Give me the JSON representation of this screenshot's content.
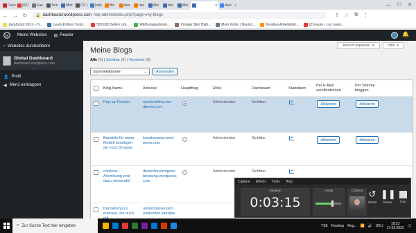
{
  "browser": {
    "tabs": [
      {
        "label": "Cezu",
        "color": "#c62828"
      },
      {
        "label": "(62)",
        "color": "#e53935"
      },
      {
        "label": "Kae",
        "color": "#777777"
      },
      {
        "label": "Tem",
        "color": "#555555"
      },
      {
        "label": "Moti",
        "color": "#3d6cb3"
      },
      {
        "label": "CV L",
        "color": "#555555"
      },
      {
        "label": "Inde",
        "color": "#3b7fc4"
      },
      {
        "label": "Blo",
        "color": "#f57c00"
      },
      {
        "label": "den",
        "color": "#f57c00"
      },
      {
        "label": "neu",
        "color": "#f57c00"
      },
      {
        "label": "Mei",
        "color": "#3d6cb3"
      },
      {
        "label": "Mei",
        "color": "#3d6cb3"
      },
      {
        "label": "Mei",
        "color": "#3d6cb3"
      },
      {
        "label": "",
        "color": "#3d6cb3"
      },
      {
        "label": "deut",
        "color": "#4285f4"
      }
    ],
    "new_tab_label": "+",
    "window_controls": [
      "—",
      "☐",
      "✕"
    ],
    "url_domain": "dashboard.wordpress.com",
    "url_path": "/wp-admin/index.php?page=my-blogs",
    "bookmarks": [
      {
        "label": "JavaScript 2021 – Ti...",
        "color": "#f0db4f"
      },
      {
        "label": "Learn Python Tutori...",
        "color": "#3776ab"
      },
      {
        "label": "582.000 Seiten Unt...",
        "color": "#e53935"
      },
      {
        "label": "WEB-paspadorws...",
        "color": "#4caf50"
      },
      {
        "label": "Vintage Slim High...",
        "color": "#8d6e63"
      },
      {
        "label": "Mein Konto | Deutsc...",
        "color": "#607d8b"
      },
      {
        "label": "Kreative Arbeitsblät...",
        "color": "#ff9800"
      },
      {
        "label": "(2) Fauré - Les roses...",
        "color": "#e53935"
      }
    ]
  },
  "adminbar": {
    "my_sites": "Meine Websites",
    "reader": "Reader"
  },
  "sidebar": {
    "back": "Websites durchstöbern",
    "site_name": "Global Dashboard",
    "site_url": "dashboard.wordpress.com",
    "profile": "Profil",
    "collapse": "Menü einklappen"
  },
  "main": {
    "screen_options": "Ansicht anpassen",
    "help": "Hilfe",
    "title": "Meine Blogs",
    "filter_all": "Alle",
    "filter_all_count": "(6)",
    "filter_visible": "Sichtbar",
    "filter_visible_count": "(6)",
    "filter_hidden": "Versteckt",
    "filter_hidden_count": "(0)",
    "sep": "|",
    "bulk_actions": "Sammelaktionen",
    "apply": "Anwenden"
  },
  "table": {
    "headers": {
      "name": "Blog-Name",
      "address": "Adresse",
      "main_blog": "Hauptblog",
      "role": "Rolle",
      "dashboard": "Dashboard",
      "stats": "Statistiken",
      "email_1": "Per E-Mail",
      "email_2": "veröffentlichen",
      "vote_1": "Per Stimme",
      "vote_2": "bloggen"
    },
    "rows": [
      {
        "name": [
          "Pop-up-Fenster"
        ],
        "address": [
          "murdemilkey.wor",
          "dpress.com"
        ],
        "role": "Administrator",
        "dashboard": "Sichtbar",
        "email": "Aktivieren",
        "vote": "Aktivieren",
        "main": true
      },
      {
        "name": [
          "Bausteln für unser",
          "Modell benötigen",
          "wir noch Dropout"
        ],
        "address": [
          "konakovanja.word",
          "press.com"
        ],
        "role": "Administrator",
        "dashboard": "Sichtbar",
        "email": "Aktivieren",
        "vote": "Aktivieren",
        "main": false
      },
      {
        "name": [
          "continue -",
          "Anweisung wird",
          "dazu verwendet"
        ],
        "address": [
          "deutschevermgens",
          "beratung.wordpress",
          "com"
        ],
        "role": "Administrator",
        "dashboard": "Sichtbar",
        "email": "",
        "vote": "",
        "main": false
      },
      {
        "name": [
          "Darstellung zu",
          "erlernen, die auch",
          "mit"
        ],
        "address": [
          "umsetzsteversam",
          "melkonten.wordpre"
        ],
        "role": "",
        "dashboard": "",
        "email": "",
        "vote": "",
        "main": false
      }
    ]
  },
  "capture": {
    "menu": [
      "Capture",
      "Effects",
      "Tools",
      "Help"
    ],
    "duration_label": "Duration",
    "duration": "0:03:15",
    "audio_label": "Audio",
    "camera_label": "Camera",
    "delete": "Delete",
    "pause": "Pause",
    "stop": "Stop"
  },
  "taskbar": {
    "search_placeholder": "Zur Suche Text hier eingeben",
    "desktop": "Desktop",
    "app_label": "Reg...",
    "lang": "DEU",
    "time": "18:23",
    "date": "17.09.2022",
    "temp": "TSK",
    "apps": [
      "#f4b400",
      "#0078d4",
      "#e53935",
      "#2e7d32",
      "#7b1fa2",
      "#0078d4",
      "#d83b01",
      "#1e88e5"
    ]
  }
}
